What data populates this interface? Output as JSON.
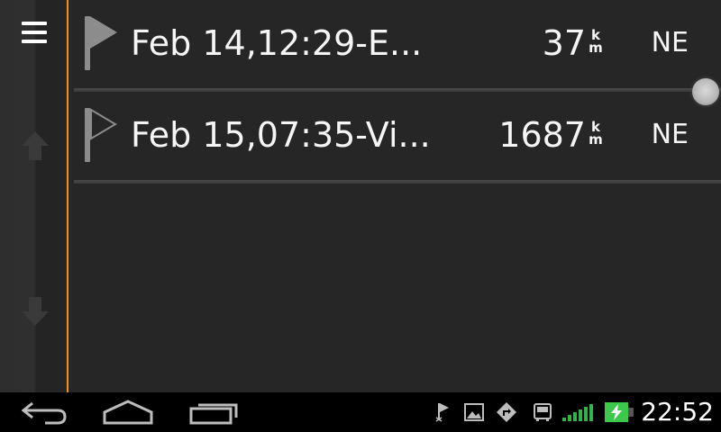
{
  "rail": {
    "menu_icon": "hamburger-menu-icon",
    "up_icon": "arrow-up-icon",
    "down_icon": "arrow-down-icon"
  },
  "list": {
    "items": [
      {
        "flag_icon": "flag-filled-icon",
        "title": "Feb 14,12:29-E...",
        "distance": "37",
        "unit_top": "k",
        "unit_bottom": "m",
        "direction": "NE"
      },
      {
        "flag_icon": "flag-outline-icon",
        "title": "Feb 15,07:35-Vi...",
        "distance": "1687",
        "unit_top": "k",
        "unit_bottom": "m",
        "direction": "NE"
      }
    ]
  },
  "navbar": {
    "back_icon": "back-icon",
    "home_icon": "home-icon",
    "recent_icon": "recent-apps-icon",
    "status_icons": [
      "flag-notification-icon",
      "image-notification-icon",
      "navigation-notification-icon",
      "bus-notification-icon",
      "signal-icon",
      "battery-charging-icon"
    ],
    "clock": "22:52"
  },
  "colors": {
    "background": "#262626",
    "accent": "#f0901f",
    "signal": "#2fb34a",
    "battery": "#3cc84a"
  }
}
